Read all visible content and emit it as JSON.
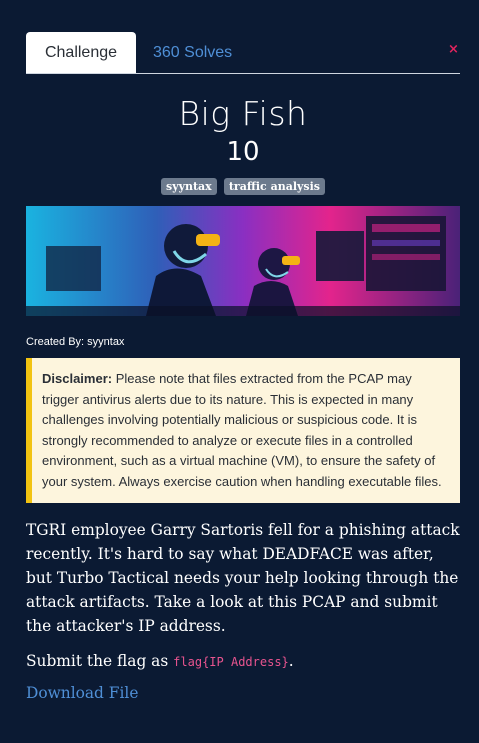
{
  "tabs": {
    "challenge": "Challenge",
    "solves": "360 Solves"
  },
  "close_icon": "×",
  "challenge": {
    "title": "Big Fish",
    "points": "10",
    "tags": [
      "syyntax",
      "traffic analysis"
    ],
    "created_by": "Created By: syyntax",
    "disclaimer_label": "Disclaimer:",
    "disclaimer_text": "Please note that files extracted from the PCAP may trigger antivirus alerts due to its nature. This is expected in many challenges involving potentially malicious or suspicious code. It is strongly recommended to analyze or execute files in a controlled environment, such as a virtual machine (VM), to ensure the safety of your system. Always exercise caution when handling executable files.",
    "description": "TGRI employee Garry Sartoris fell for a phishing attack recently. It's hard to say what DEADFACE was after, but Turbo Tactical needs your help looking through the attack artifacts. Take a look at this PCAP and submit the attacker's IP address.",
    "submit_prefix": "Submit the flag as",
    "flag_format": "flag{IP Address}",
    "submit_suffix": ".",
    "download_label": "Download File"
  },
  "colors": {
    "accent": "#4f8fd6",
    "background": "#0b1a33",
    "flag_code": "#e8548f",
    "disclaimer_border": "#f2c311"
  }
}
